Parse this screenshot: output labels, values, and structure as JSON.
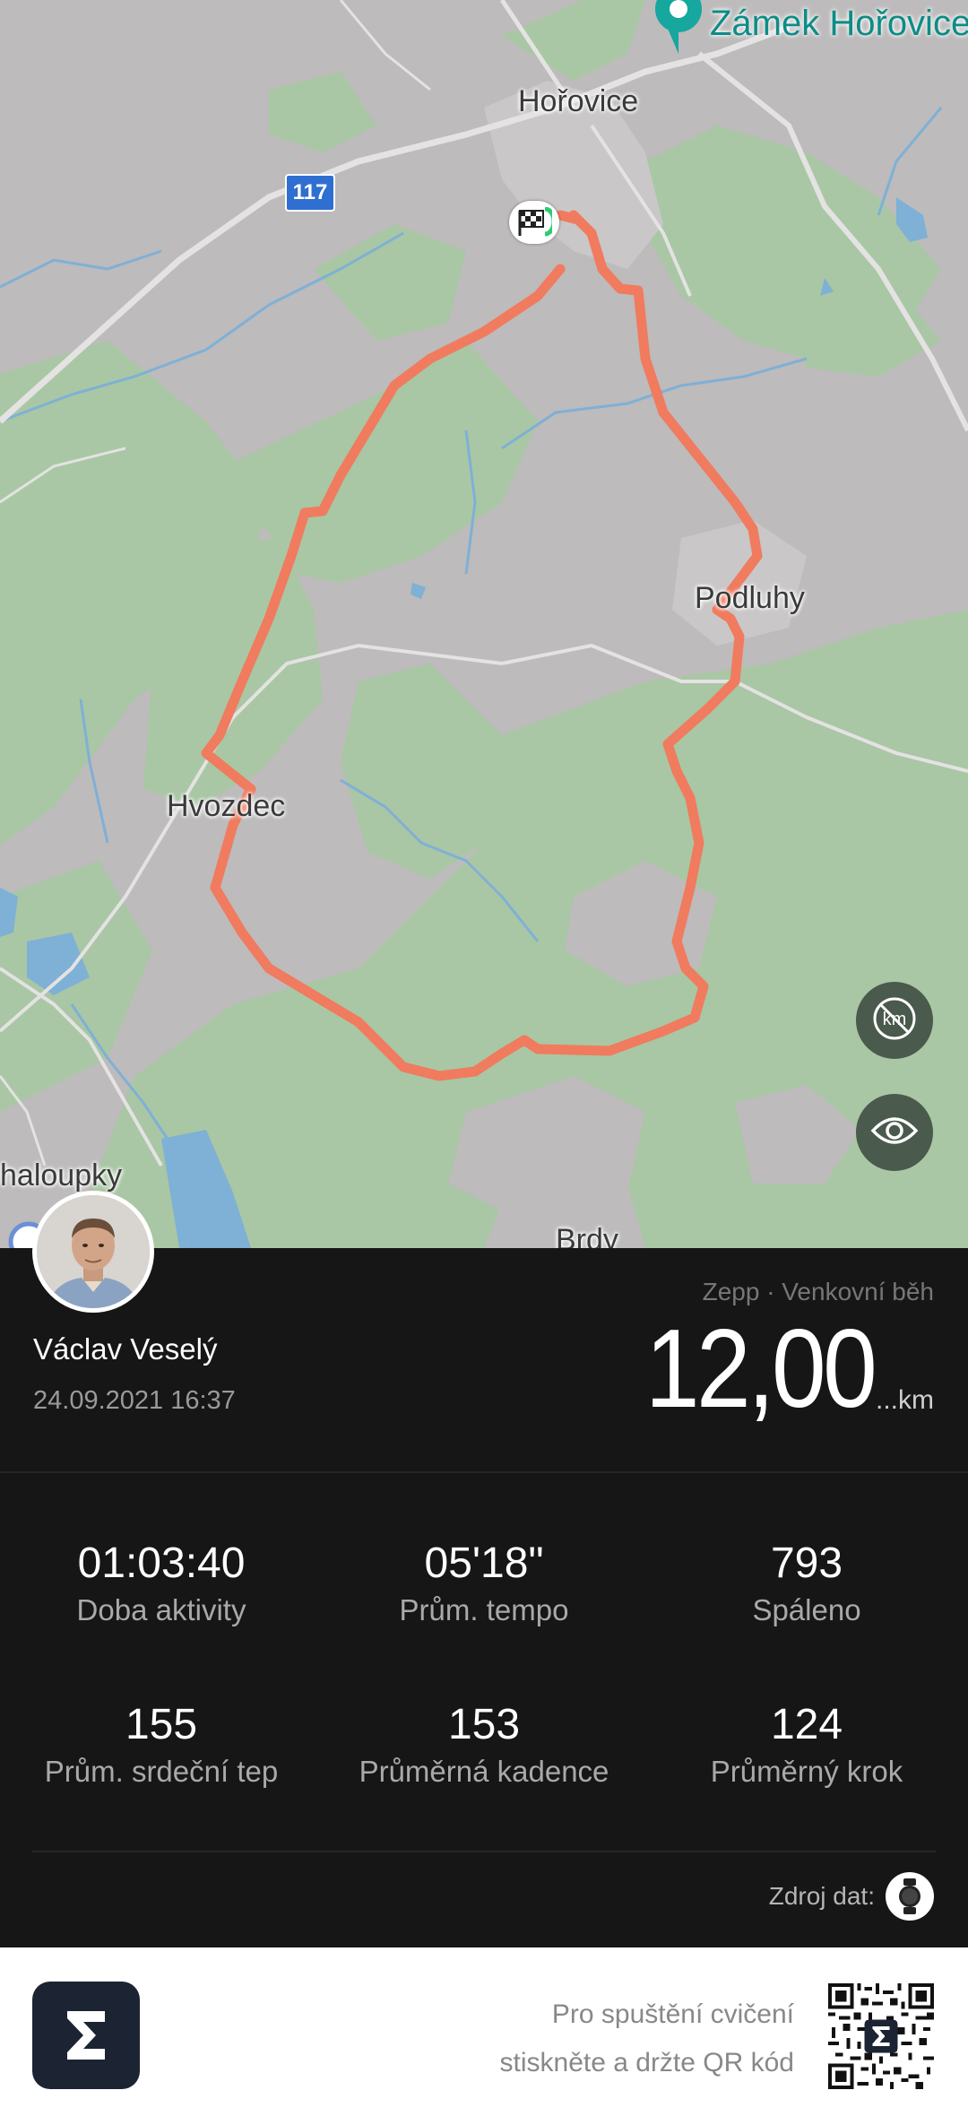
{
  "map": {
    "labels": {
      "horovice": "Hořovice",
      "zamek": "Zámek Hořovice",
      "podluhy": "Podluhy",
      "hvozdec": "Hvozdec",
      "chaloupky": "haloupky",
      "brdy": "Brdy"
    },
    "road_number": "117",
    "route_color": "#f07b5e",
    "buttons": [
      "km-off-icon",
      "eye-icon"
    ]
  },
  "activity": {
    "user_name": "Václav Veselý",
    "date": "24.09.2021 16:37",
    "source": "Zepp · Venkovní běh",
    "distance": "12,00",
    "distance_unit": "...km"
  },
  "stats": [
    {
      "value": "01:03:40",
      "label": "Doba aktivity"
    },
    {
      "value": "05'18\"",
      "label": "Prům. tempo"
    },
    {
      "value": "793",
      "label": "Spáleno"
    },
    {
      "value": "155",
      "label": "Prům. srdeční tep"
    },
    {
      "value": "153",
      "label": "Průměrná kadence"
    },
    {
      "value": "124",
      "label": "Průměrný krok"
    }
  ],
  "data_source_label": "Zdroj dat:",
  "footer": {
    "line1": "Pro spuštění cvičení",
    "line2": "stiskněte a držte QR kód"
  }
}
